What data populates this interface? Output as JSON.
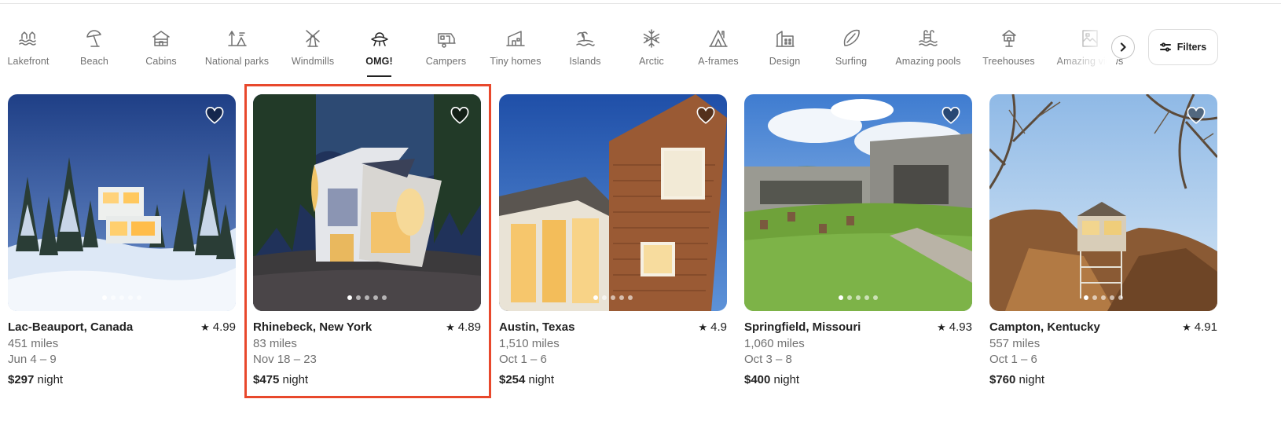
{
  "categories": [
    {
      "label": "Lakefront",
      "icon": "lakefront-icon",
      "active": false
    },
    {
      "label": "Beach",
      "icon": "beach-umbrella-icon",
      "active": false
    },
    {
      "label": "Cabins",
      "icon": "cabin-icon",
      "active": false
    },
    {
      "label": "National parks",
      "icon": "national-parks-icon",
      "active": false
    },
    {
      "label": "Windmills",
      "icon": "windmill-icon",
      "active": false
    },
    {
      "label": "OMG!",
      "icon": "ufo-house-icon",
      "active": true
    },
    {
      "label": "Campers",
      "icon": "camper-icon",
      "active": false
    },
    {
      "label": "Tiny homes",
      "icon": "tiny-home-icon",
      "active": false
    },
    {
      "label": "Islands",
      "icon": "island-icon",
      "active": false
    },
    {
      "label": "Arctic",
      "icon": "snowflake-icon",
      "active": false
    },
    {
      "label": "A-frames",
      "icon": "a-frame-icon",
      "active": false
    },
    {
      "label": "Design",
      "icon": "design-icon",
      "active": false
    },
    {
      "label": "Surfing",
      "icon": "surfboard-icon",
      "active": false
    },
    {
      "label": "Amazing pools",
      "icon": "pool-icon",
      "active": false
    },
    {
      "label": "Treehouses",
      "icon": "treehouse-icon",
      "active": false
    },
    {
      "label": "Amazing views",
      "icon": "view-icon",
      "active": false
    }
  ],
  "filters": {
    "label": "Filters",
    "icon": "filter-sliders-icon"
  },
  "listings": [
    {
      "location": "Lac-Beauport, Canada",
      "rating": "4.99",
      "distance": "451 miles",
      "dates": "Jun 4 – 9",
      "price": "$297",
      "price_unit": "night",
      "photo_count": 5,
      "active_photo": 0
    },
    {
      "location": "Rhinebeck, New York",
      "rating": "4.89",
      "distance": "83 miles",
      "dates": "Nov 18 – 23",
      "price": "$475",
      "price_unit": "night",
      "photo_count": 5,
      "active_photo": 0
    },
    {
      "location": "Austin, Texas",
      "rating": "4.9",
      "distance": "1,510 miles",
      "dates": "Oct 1 – 6",
      "price": "$254",
      "price_unit": "night",
      "photo_count": 5,
      "active_photo": 0
    },
    {
      "location": "Springfield, Missouri",
      "rating": "4.93",
      "distance": "1,060 miles",
      "dates": "Oct 3 – 8",
      "price": "$400",
      "price_unit": "night",
      "photo_count": 5,
      "active_photo": 0
    },
    {
      "location": "Campton, Kentucky",
      "rating": "4.91",
      "distance": "557 miles",
      "dates": "Oct 1 – 6",
      "price": "$760",
      "price_unit": "night",
      "photo_count": 5,
      "active_photo": 0
    }
  ],
  "colors": {
    "highlight_border": "#e8482c",
    "text_primary": "#222222",
    "text_secondary": "#717171"
  }
}
